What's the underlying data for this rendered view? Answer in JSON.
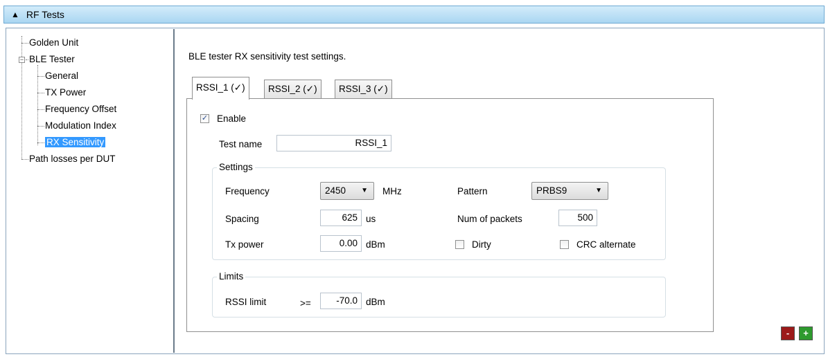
{
  "header": {
    "title": "RF Tests",
    "arrow_icon": "▲"
  },
  "tree": {
    "items": [
      {
        "label": "Golden Unit"
      },
      {
        "label": "BLE Tester",
        "expander": "−"
      },
      {
        "label": "General"
      },
      {
        "label": "TX Power"
      },
      {
        "label": "Frequency Offset"
      },
      {
        "label": "Modulation Index"
      },
      {
        "label": "RX Sensitivity",
        "selected": true
      },
      {
        "label": "Path losses per DUT"
      }
    ]
  },
  "main": {
    "description": "BLE tester RX sensitivity test settings.",
    "tabs": [
      {
        "label": "RSSI_1 (✓)",
        "active": true
      },
      {
        "label": "RSSI_2 (✓)"
      },
      {
        "label": "RSSI_3 (✓)"
      }
    ],
    "enable": {
      "label": "Enable",
      "checked": true,
      "mark": "✓"
    },
    "test_name": {
      "label": "Test name",
      "value": "RSSI_1"
    },
    "settings": {
      "title": "Settings",
      "frequency": {
        "label": "Frequency",
        "value": "2450",
        "unit": "MHz"
      },
      "pattern": {
        "label": "Pattern",
        "value": "PRBS9"
      },
      "spacing": {
        "label": "Spacing",
        "value": "625",
        "unit": "us"
      },
      "num_packets": {
        "label": "Num of packets",
        "value": "500"
      },
      "tx_power": {
        "label": "Tx power",
        "value": "0.00",
        "unit": "dBm"
      },
      "dirty": {
        "label": "Dirty",
        "checked": false
      },
      "crc_alternate": {
        "label": "CRC alternate",
        "checked": false
      }
    },
    "limits": {
      "title": "Limits",
      "rssi_limit": {
        "label": "RSSI limit",
        "operator": ">=",
        "value": "-70.0",
        "unit": "dBm"
      }
    }
  },
  "buttons": {
    "remove_label": "-",
    "add_label": "+"
  },
  "colors": {
    "header_bg": "#aad6f2",
    "selection": "#3399ff",
    "remove": "#9c1a1a",
    "add": "#2e9a2e"
  }
}
